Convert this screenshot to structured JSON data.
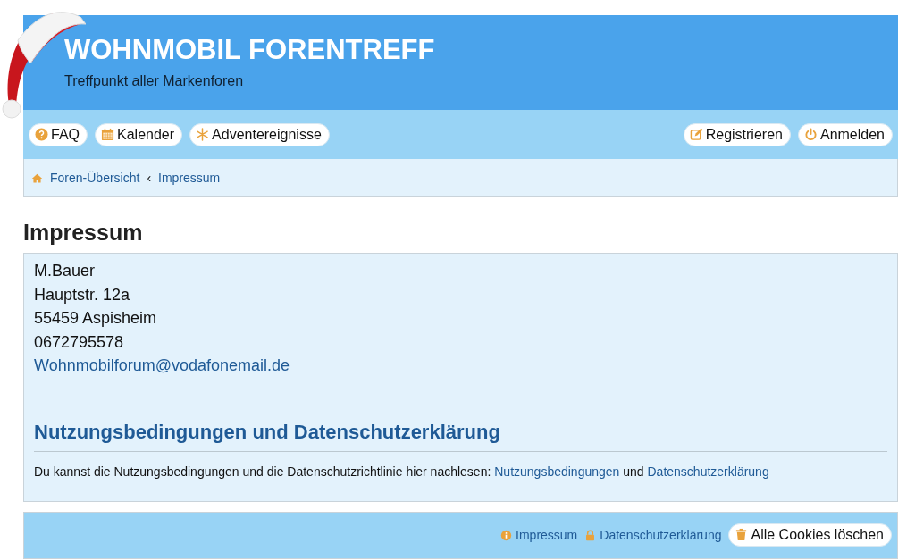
{
  "header": {
    "title": "WOHNMOBIL FORENTREFF",
    "subtitle": "Treffpunkt aller Markenforen"
  },
  "nav_left": [
    "FAQ",
    "Kalender",
    "Adventereignisse"
  ],
  "nav_right": [
    "Registrieren",
    "Anmelden"
  ],
  "breadcrumb": [
    "Foren-Übersicht",
    "Impressum"
  ],
  "breadcrumb_separator": "‹",
  "page_title": "Impressum",
  "address": [
    "M.Bauer",
    "Hauptstr. 12a",
    "55459 Aspisheim",
    "0672795578"
  ],
  "email": "Wohnmobilforum@vodafonemail.de",
  "section_title": "Nutzungsbedingungen und Datenschutzerklärung",
  "notice": {
    "text": "Du kannst die Nutzungsbedingungen und die Datenschutzrichtlinie hier nachlesen: ",
    "link_1": "Nutzungsbedingungen",
    "joiner": " und ",
    "link_2": "Datenschutzerklärung"
  },
  "footer": {
    "links": [
      "Impressum",
      "Datenschutzerklärung"
    ],
    "button": "Alle Cookies löschen"
  }
}
